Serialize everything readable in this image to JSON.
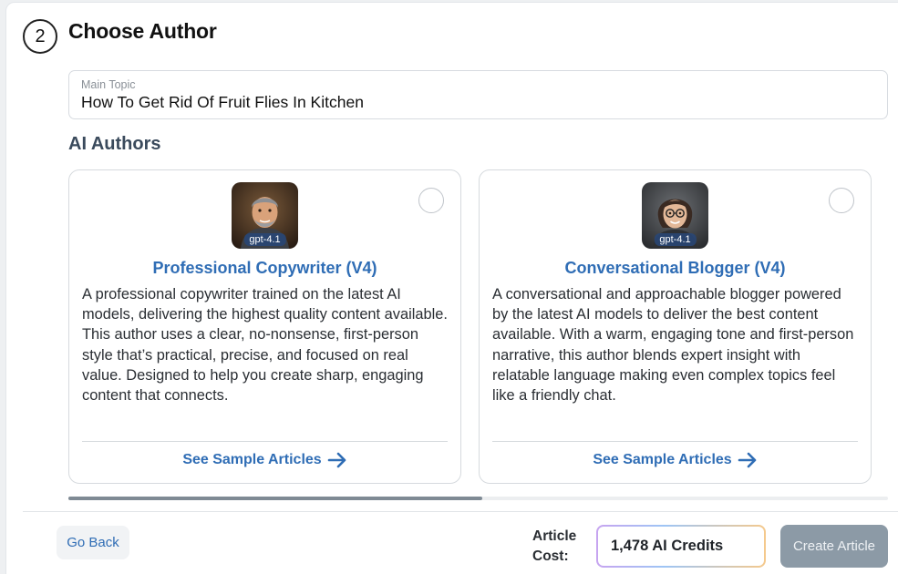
{
  "step": {
    "number": "2",
    "title": "Choose Author"
  },
  "topic": {
    "label": "Main Topic",
    "value": "How To Get Rid Of Fruit Flies In Kitchen"
  },
  "authors_section": {
    "title": "AI Authors",
    "cards": [
      {
        "model": "gpt-4.1",
        "name": "Professional Copywriter (V4)",
        "description": "A professional copywriter trained on the latest AI models, delivering the highest quality content available. This author uses a clear, no-nonsense, first-person style that’s practical, precise, and focused on real value. Designed to help you create sharp, engaging content that connects.",
        "link_label": "See Sample Articles",
        "selected": false
      },
      {
        "model": "gpt-4.1",
        "name": "Conversational Blogger (V4)",
        "description": "A conversational and approachable blogger powered by the latest AI models to deliver the best content available. With a warm, engaging tone and first-person narrative, this author blends expert insight with relatable language making even complex topics feel like a friendly chat.",
        "link_label": "See Sample Articles",
        "selected": false
      }
    ]
  },
  "scroll": {
    "position_fraction": 0.5
  },
  "footer": {
    "back_label": "Go Back",
    "cost_label_line1": "Article",
    "cost_label_line2": "Cost:",
    "credits": "1,478 AI Credits",
    "create_label": "Create Article"
  },
  "colors": {
    "link": "#2f6db5",
    "create_button": "#8c9aa6",
    "heading": "#3a4a5c"
  }
}
